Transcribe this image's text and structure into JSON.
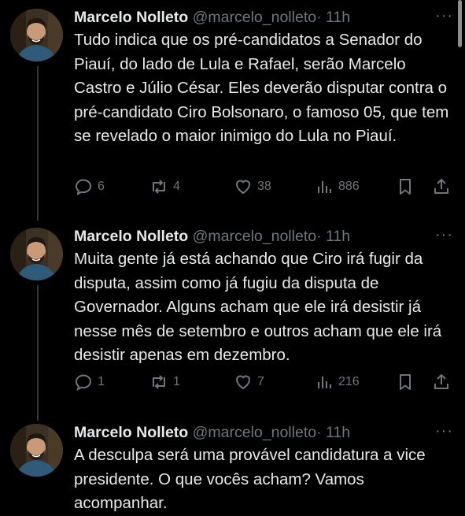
{
  "tweets": [
    {
      "name": "Marcelo Nolleto",
      "handle": "@marcelo_nolleto",
      "time": "· 11h",
      "more": "···",
      "text": "Tudo indica que os pré-candidatos a Senador do Piauí, do lado de Lula e Rafael, serão Marcelo Castro e Júlio César. Eles deverão disputar contra o pré-candidato Ciro Bolsonaro, o famoso 05, que tem se revelado o maior inimigo do Lula no Piauí.",
      "replies": "6",
      "reposts": "4",
      "likes": "38",
      "views": "886"
    },
    {
      "name": "Marcelo Nolleto",
      "handle": "@marcelo_nolleto",
      "time": "· 11h",
      "more": "···",
      "text": "Muita gente já está achando que Ciro irá fugir da disputa, assim como já fugiu da disputa de Governador. Alguns acham que ele irá desistir já nesse mês de setembro e outros acham que ele irá desistir apenas em dezembro.",
      "replies": "1",
      "reposts": "1",
      "likes": "7",
      "views": "216"
    },
    {
      "name": "Marcelo Nolleto",
      "handle": "@marcelo_nolleto",
      "time": "· 11h",
      "more": "···",
      "text": "A desculpa será uma provável candidatura a vice presidente. O que vocês acham? Vamos acompanhar."
    }
  ],
  "colors": {
    "background": "#000000",
    "text": "#e7e9ea",
    "muted": "#71767b",
    "thread_line": "#333639"
  }
}
